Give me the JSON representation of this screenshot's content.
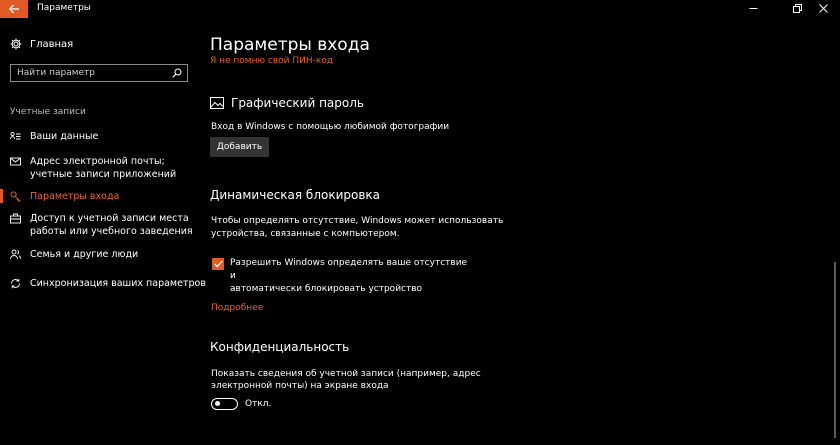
{
  "window": {
    "title": "Параметры"
  },
  "sidebar": {
    "home_label": "Главная",
    "search_placeholder": "Найти параметр",
    "section_label": "Учетные записи",
    "items": [
      {
        "label": "Ваши данные",
        "icon": "person-card-icon"
      },
      {
        "label": "Адрес электронной почты; учетные записи приложений",
        "icon": "mail-icon"
      },
      {
        "label": "Параметры входа",
        "icon": "key-icon",
        "active": true
      },
      {
        "label": "Доступ к учетной записи места работы или учебного заведения",
        "icon": "briefcase-icon"
      },
      {
        "label": "Семья и другие люди",
        "icon": "people-icon"
      },
      {
        "label": "Синхронизация ваших параметров",
        "icon": "sync-icon"
      }
    ]
  },
  "main": {
    "title": "Параметры входа",
    "pin_link": "Я не помню свой ПИН-код",
    "picture_password": {
      "heading": "Графический пароль",
      "description": "Вход в Windows с помощью любимой фотографии",
      "add_button": "Добавить"
    },
    "dynamic_lock": {
      "heading": "Динамическая блокировка",
      "description_line1": "Чтобы определять отсутствие, Windows может использовать",
      "description_line2": "устройства, связанные с компьютером.",
      "checkbox_line1": "Разрешить Windows определять ваше отсутствие и",
      "checkbox_line2": "автоматически блокировать устройство",
      "checkbox_checked": true,
      "more_link": "Подробнее"
    },
    "privacy": {
      "heading": "Конфиденциальность",
      "description_line1": "Показать сведения об учетной записи (например, адрес",
      "description_line2": "электронной почты) на экране входа",
      "toggle_state": "Откл.",
      "toggle_on": false
    }
  },
  "colors": {
    "accent": "#e05a24",
    "background": "#000000",
    "text": "#ffffff"
  }
}
